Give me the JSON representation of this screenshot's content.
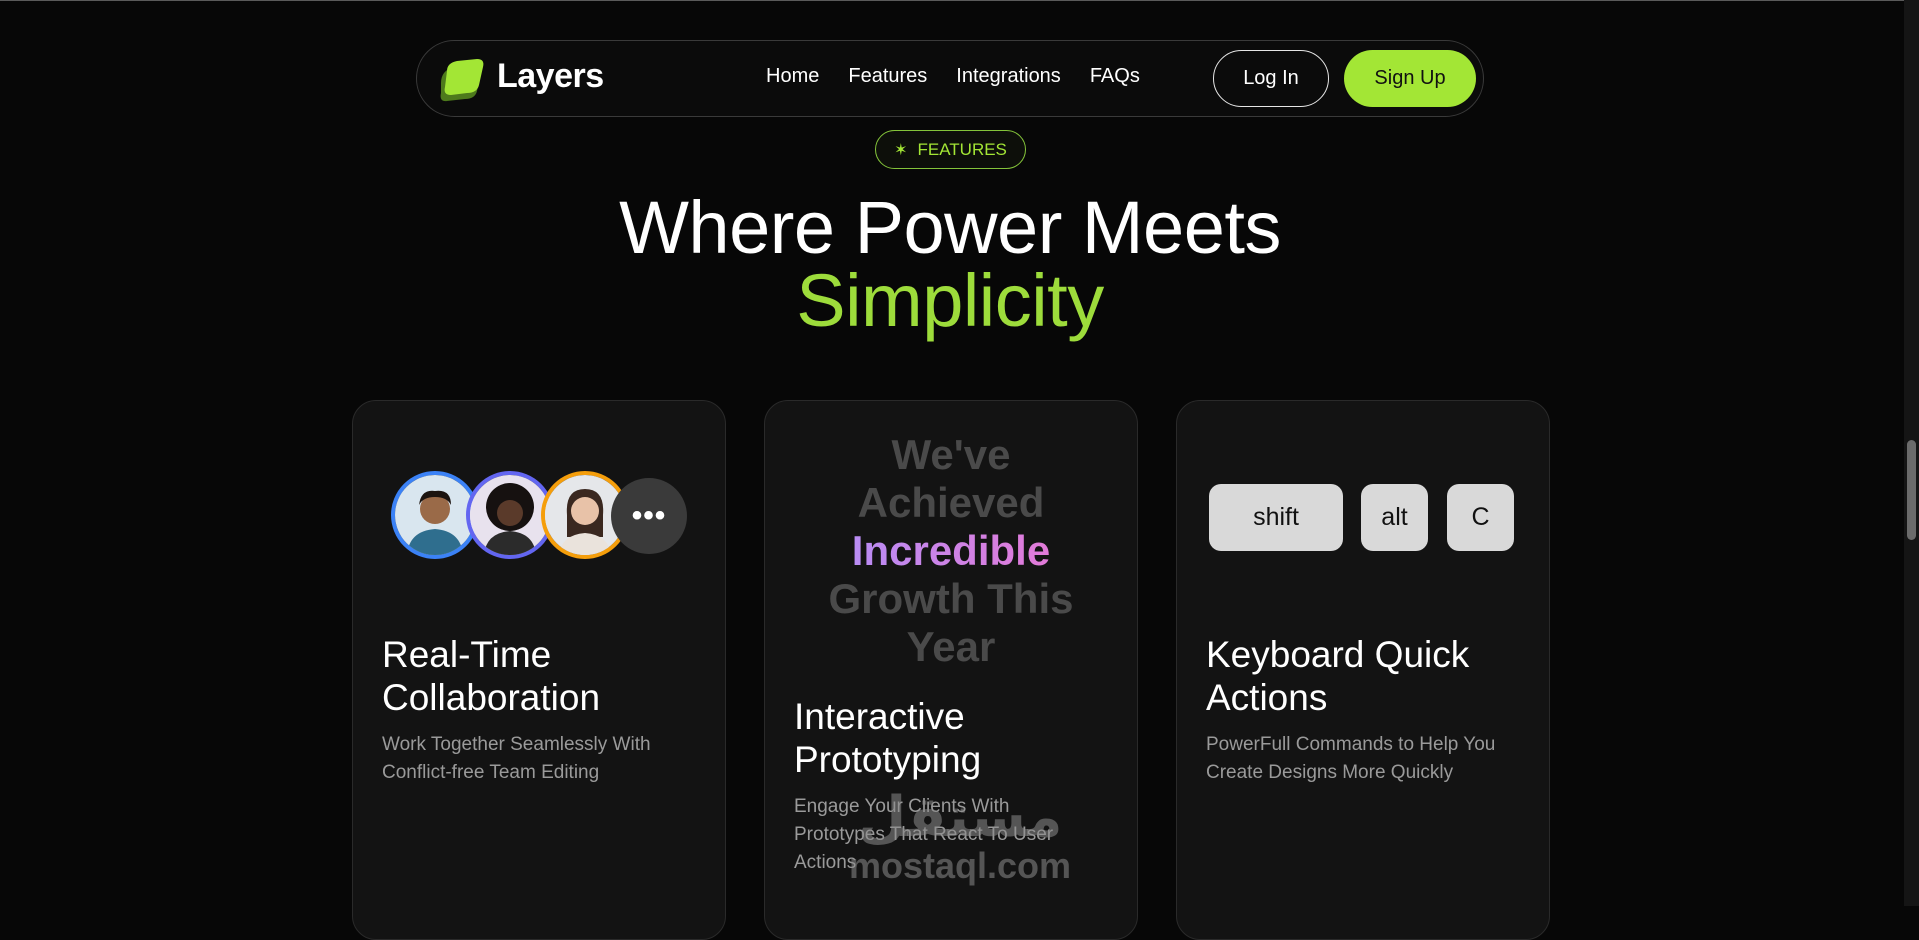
{
  "nav": {
    "brand": "Layers",
    "links": [
      "Home",
      "Features",
      "Integrations",
      "FAQs"
    ],
    "login": "Log In",
    "signup": "Sign Up"
  },
  "badge": {
    "icon": "asterisk-icon",
    "label": "FEATURES"
  },
  "headline": {
    "line1": "Where Power Meets",
    "line2": "Simplicity"
  },
  "cards": [
    {
      "title_line1": "Real-Time",
      "title_line2": "Collaboration",
      "desc_line1": "Work Together Seamlessly With",
      "desc_line2": "Conflict-free Team Editing",
      "more": "•••"
    },
    {
      "growth": [
        "We've",
        "Achieved",
        "Incredible",
        "Growth This",
        "Year"
      ],
      "title_line1": "Interactive",
      "title_line2": "Prototyping",
      "desc_line1": "Engage Your Clients With",
      "desc_line2": "Prototypes That React To User",
      "desc_line3": "Actions"
    },
    {
      "keys": [
        "shift",
        "alt",
        "C"
      ],
      "title_line1": "Keyboard Quick",
      "title_line2": "Actions",
      "desc_line1": "PowerFull Commands to Help You",
      "desc_line2": "Create Designs More Quickly"
    }
  ],
  "watermark": {
    "arabic": "مستقل",
    "latin": "mostaql.com"
  },
  "colors": {
    "accent": "#a3e635",
    "background": "#070707",
    "card": "#131313"
  }
}
